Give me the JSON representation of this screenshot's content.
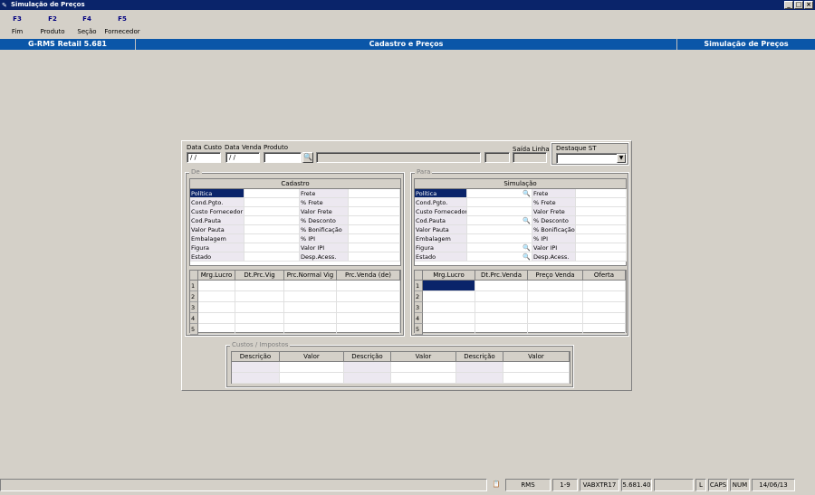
{
  "window": {
    "title": "Simulação de Preços"
  },
  "fkeys": [
    {
      "key": "F3",
      "label": "Fim"
    },
    {
      "key": "F2",
      "label": "Produto"
    },
    {
      "key": "F4",
      "label": "Seção"
    },
    {
      "key": "F5",
      "label": "Fornecedor"
    }
  ],
  "banner": {
    "left": "G-RMS Retail 5.681",
    "center": "Cadastro e Preços",
    "right": "Simulação de Preços"
  },
  "form": {
    "data_custo_label": "Data Custo",
    "data_custo_value": " / /",
    "data_venda_label": "Data Venda",
    "data_venda_value": " / /",
    "produto_label": "Produto",
    "saida_linha_label": "Saída Linha",
    "destaque_st_label": "Destaque ST"
  },
  "de": {
    "title": "De",
    "grid_title": "Cadastro",
    "rows": [
      [
        "Política",
        "Frete"
      ],
      [
        "Cond.Pgto.",
        "% Frete"
      ],
      [
        "Custo Fornecedor",
        "Valor Frete"
      ],
      [
        "Cod.Pauta",
        "% Desconto"
      ],
      [
        "Valor Pauta",
        "% Bonificação"
      ],
      [
        "Embalagem",
        "% IPI"
      ],
      [
        "Figura",
        "Valor IPI"
      ],
      [
        "Estado",
        "Desp.Acess."
      ]
    ],
    "cols": [
      "Mrg.Lucro",
      "Dt.Prc.Vig",
      "Prc.Normal Vig",
      "Prc.Venda (de)"
    ],
    "rownums": [
      "1",
      "2",
      "3",
      "4",
      "5"
    ]
  },
  "para": {
    "title": "Para",
    "grid_title": "Simulação",
    "rows": [
      [
        "Política",
        "Frete"
      ],
      [
        "Cond.Pgto.",
        "% Frete"
      ],
      [
        "Custo Fornecedor",
        "Valor Frete"
      ],
      [
        "Cod.Pauta",
        "% Desconto"
      ],
      [
        "Valor Pauta",
        "% Bonificação"
      ],
      [
        "Embalagem",
        "% IPI"
      ],
      [
        "Figura",
        "Valor IPI"
      ],
      [
        "Estado",
        "Desp.Acess."
      ]
    ],
    "cols": [
      "Mrg.Lucro",
      "Dt.Prc.Venda",
      "Preço Venda",
      "Oferta"
    ],
    "rownums": [
      "1",
      "2",
      "3",
      "4",
      "5"
    ]
  },
  "custos": {
    "title": "Custos / Impostos",
    "cols": [
      "Descrição",
      "Valor",
      "Descrição",
      "Valor",
      "Descrição",
      "Valor"
    ]
  },
  "status": {
    "rms": "RMS",
    "range": "1-9",
    "server": "VABXTR17",
    "version": "5.681.40",
    "l": "L",
    "caps": "CAPS",
    "num": "NUM",
    "date": "14/06/13"
  }
}
